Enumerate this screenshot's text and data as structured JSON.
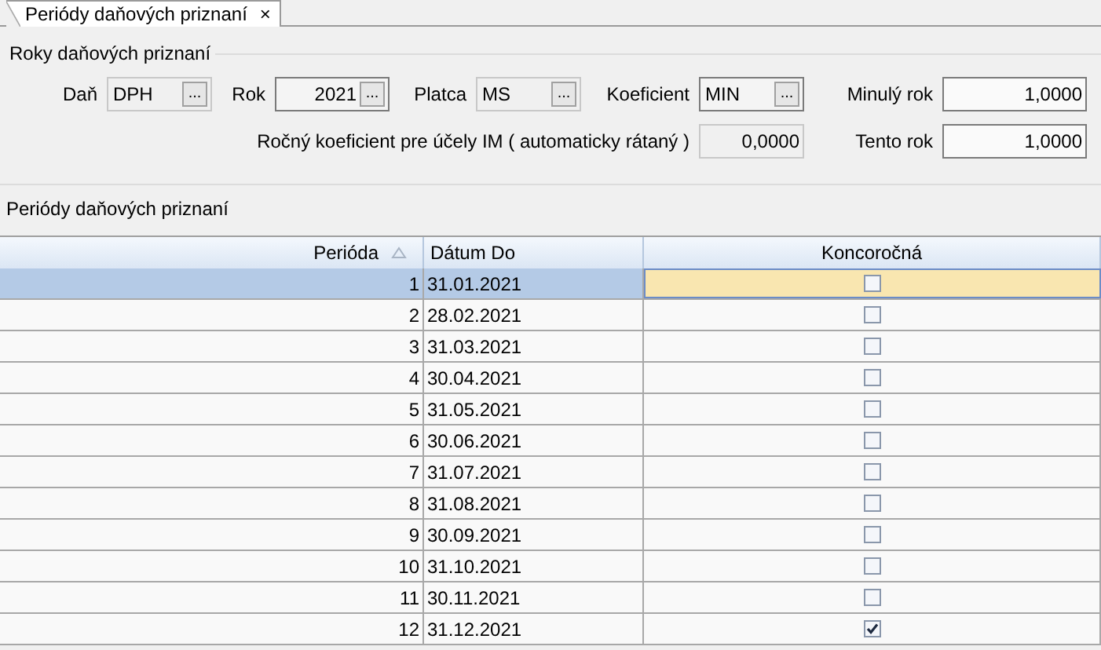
{
  "tab": {
    "label": "Periódy daňových priznaní",
    "close": "×",
    "selected": true
  },
  "group": {
    "title": "Roky daňových priznaní",
    "fields": [
      {
        "label": "Daň",
        "value": "DPH",
        "browse": "...",
        "disabled": true
      },
      {
        "label": "Rok",
        "value": "2021",
        "browse": "...",
        "disabled": false
      },
      {
        "label": "Platca",
        "value": "MS",
        "browse": "...",
        "disabled": true
      },
      {
        "label": "Koeficient",
        "value": "MIN",
        "browse": "...",
        "disabled": false
      },
      {
        "label": "Minulý rok",
        "value": "1,0000",
        "disabled": false
      },
      {
        "label": "Ročný koeficient pre účely IM ( automaticky rátaný )",
        "value": "0,0000",
        "disabled": true
      },
      {
        "label": "Tento rok",
        "value": "1,0000",
        "disabled": false
      }
    ]
  },
  "section_title": "Periódy daňových priznaní",
  "table": {
    "columns": [
      {
        "label": "Perióda",
        "sorted": true
      },
      {
        "label": "Dátum Do",
        "sorted": false
      },
      {
        "label": "Koncoročná",
        "sorted": false
      }
    ],
    "rows": [
      {
        "period": "1",
        "date": "31.01.2021",
        "year_end": false,
        "selected": true
      },
      {
        "period": "2",
        "date": "28.02.2021",
        "year_end": false,
        "selected": false
      },
      {
        "period": "3",
        "date": "31.03.2021",
        "year_end": false,
        "selected": false
      },
      {
        "period": "4",
        "date": "30.04.2021",
        "year_end": false,
        "selected": false
      },
      {
        "period": "5",
        "date": "31.05.2021",
        "year_end": false,
        "selected": false
      },
      {
        "period": "6",
        "date": "30.06.2021",
        "year_end": false,
        "selected": false
      },
      {
        "period": "7",
        "date": "31.07.2021",
        "year_end": false,
        "selected": false
      },
      {
        "period": "8",
        "date": "31.08.2021",
        "year_end": false,
        "selected": false
      },
      {
        "period": "9",
        "date": "30.09.2021",
        "year_end": false,
        "selected": false
      },
      {
        "period": "10",
        "date": "31.10.2021",
        "year_end": false,
        "selected": false
      },
      {
        "period": "11",
        "date": "30.11.2021",
        "year_end": false,
        "selected": false
      },
      {
        "period": "12",
        "date": "31.12.2021",
        "year_end": true,
        "selected": false
      }
    ]
  }
}
